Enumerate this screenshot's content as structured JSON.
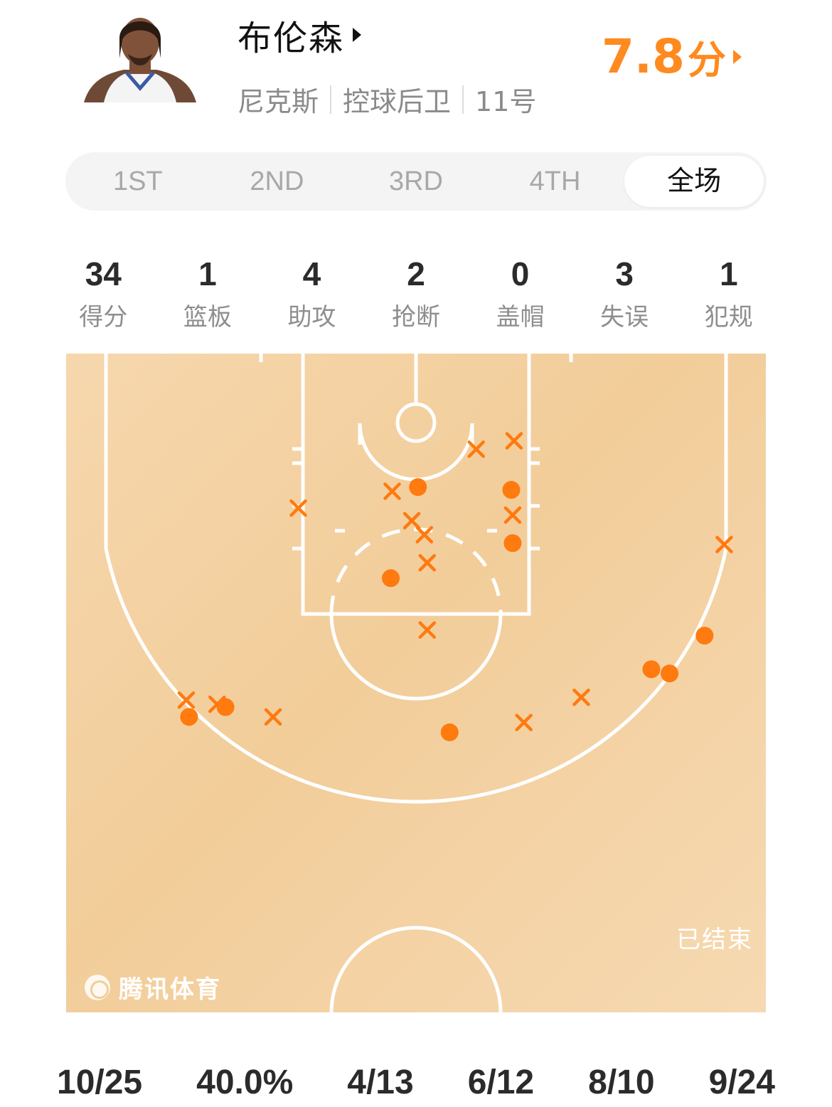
{
  "player": {
    "name": "布伦森",
    "team": "尼克斯",
    "position": "控球后卫",
    "number": "11号",
    "rating_value": "7.8",
    "rating_unit": "分"
  },
  "tabs": [
    {
      "label": "1ST",
      "active": false
    },
    {
      "label": "2ND",
      "active": false
    },
    {
      "label": "3RD",
      "active": false
    },
    {
      "label": "4TH",
      "active": false
    },
    {
      "label": "全场",
      "active": true
    }
  ],
  "stats": [
    {
      "value": "34",
      "label": "得分"
    },
    {
      "value": "1",
      "label": "篮板"
    },
    {
      "value": "4",
      "label": "助攻"
    },
    {
      "value": "2",
      "label": "抢断"
    },
    {
      "value": "0",
      "label": "盖帽"
    },
    {
      "value": "3",
      "label": "失误"
    },
    {
      "value": "1",
      "label": "犯规"
    }
  ],
  "court": {
    "status": "已结束",
    "watermark": "腾讯体育",
    "colors": {
      "made": "#ff7a0f",
      "missed": "#ff7a0f",
      "lines": "#ffffff"
    },
    "shots": [
      {
        "result": "made",
        "xft": 0.14,
        "yft": 4.6
      },
      {
        "result": "made",
        "xft": 6.8,
        "yft": 4.8
      },
      {
        "result": "made",
        "xft": 6.9,
        "yft": 8.6
      },
      {
        "result": "made",
        "xft": -1.8,
        "yft": 11.1
      },
      {
        "result": "made",
        "xft": 20.6,
        "yft": 15.2
      },
      {
        "result": "made",
        "xft": 16.8,
        "yft": 17.6
      },
      {
        "result": "made",
        "xft": 18.1,
        "yft": 17.9
      },
      {
        "result": "made",
        "xft": -13.6,
        "yft": 20.3
      },
      {
        "result": "made",
        "xft": -16.2,
        "yft": 21.0
      },
      {
        "result": "made",
        "xft": 2.4,
        "yft": 22.1
      },
      {
        "result": "missed",
        "xft": 4.3,
        "yft": 1.9
      },
      {
        "result": "missed",
        "xft": 7.0,
        "yft": 1.3
      },
      {
        "result": "missed",
        "xft": -1.7,
        "yft": 4.9
      },
      {
        "result": "missed",
        "xft": 6.9,
        "yft": 6.6
      },
      {
        "result": "missed",
        "xft": -8.4,
        "yft": 6.1
      },
      {
        "result": "missed",
        "xft": -0.3,
        "yft": 7.0
      },
      {
        "result": "missed",
        "xft": 0.6,
        "yft": 8.0
      },
      {
        "result": "missed",
        "xft": 0.8,
        "yft": 10.0
      },
      {
        "result": "missed",
        "xft": 22.0,
        "yft": 8.7
      },
      {
        "result": "missed",
        "xft": 0.8,
        "yft": 14.8
      },
      {
        "result": "missed",
        "xft": -16.4,
        "yft": 19.8
      },
      {
        "result": "missed",
        "xft": -14.2,
        "yft": 20.1
      },
      {
        "result": "missed",
        "xft": -10.2,
        "yft": 21.0
      },
      {
        "result": "missed",
        "xft": 11.8,
        "yft": 19.6
      },
      {
        "result": "missed",
        "xft": 7.7,
        "yft": 21.4
      }
    ]
  },
  "bottom_stats": [
    "10/25",
    "40.0%",
    "4/13",
    "6/12",
    "8/10",
    "9/24"
  ]
}
